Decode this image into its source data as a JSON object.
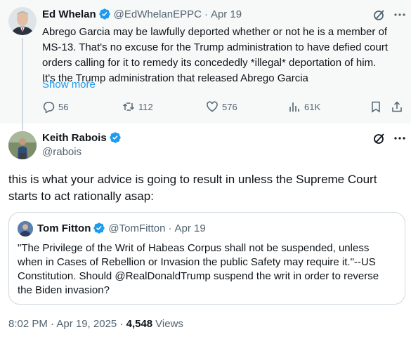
{
  "parent_tweet": {
    "author_name": "Ed Whelan",
    "author_handle": "@EdWhelanEPPC",
    "separator": "·",
    "date": "Apr 19",
    "text_lines": [
      "Abrego Garcia may be lawfully deported whether or not he is a member of",
      "MS-13. That's no excuse for the Trump administration to have defied court",
      "orders calling for it to remedy its concededly *illegal* deportation of him.",
      "It's the Trump administration that released Abrego Garcia"
    ],
    "show_more": "Show more",
    "actions": {
      "replies": "56",
      "reposts": "112",
      "likes": "576",
      "views": "61K"
    }
  },
  "main_tweet": {
    "author_name": "Keith Rabois",
    "author_handle": "@rabois",
    "text_lines": [
      "this is what your advice is going to result in unless the Supreme Court",
      "starts to act rationally asap:"
    ],
    "timestamp": "8:02 PM · Apr 19, 2025 ·",
    "views_count": "4,548",
    "views_label": "Views"
  },
  "quoted_tweet": {
    "author_name": "Tom Fitton",
    "author_handle": "@TomFitton",
    "separator": "·",
    "date": "Apr 19",
    "text_lines": [
      "\"The Privilege of the Writ of Habeas Corpus shall not be suspended, unless",
      "when in Cases of Rebellion or Invasion the public Safety may require it.\"--US",
      "Constitution.  Should @RealDonaldTrump suspend the writ in order to reverse",
      "the Biden invasion?"
    ]
  },
  "colors": {
    "accent": "#1d9bf0",
    "text": "#0f1419",
    "secondary_text": "#536471",
    "border": "#cfd9de",
    "parent_background": "#f7f9f9"
  },
  "icons": [
    "verified-badge-icon",
    "grok-icon",
    "more-icon",
    "reply-icon",
    "repost-icon",
    "like-icon",
    "views-icon",
    "bookmark-icon",
    "share-icon"
  ]
}
